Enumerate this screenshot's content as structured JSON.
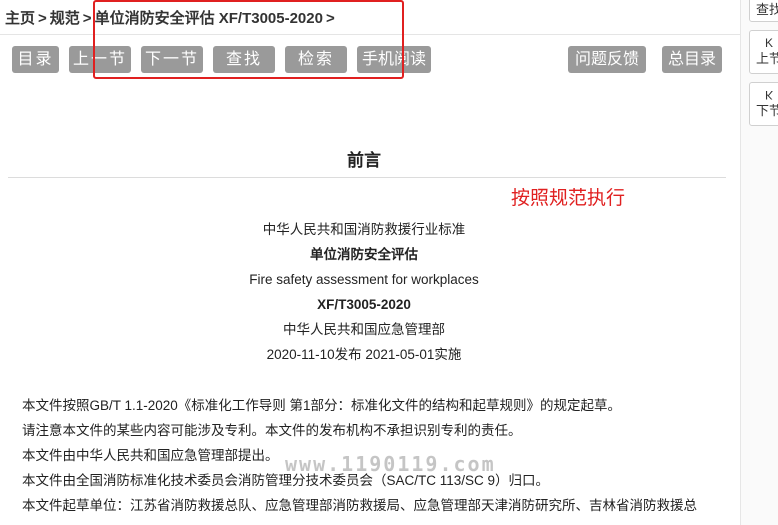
{
  "breadcrumb": {
    "home": "主页",
    "sep": ">",
    "section": "规范",
    "doc": "单位消防安全评估 XF/T3005-2020",
    "tail": ">"
  },
  "toolbar": {
    "toc": "目录",
    "prev": "上一节",
    "next": "下一节",
    "find": "查找",
    "search": "检索",
    "mobile": "手机阅读",
    "feedback": "问题反馈",
    "master_toc": "总目录"
  },
  "content": {
    "title": "前言",
    "annotation": "按照规范执行",
    "lines": [
      "中华人民共和国消防救援行业标准",
      "单位消防安全评估",
      "Fire safety assessment for workplaces",
      "XF/T3005-2020",
      "中华人民共和国应急管理部",
      "2020-11-10发布 2021-05-01实施"
    ],
    "paragraphs": [
      "本文件按照GB/T 1.1-2020《标准化工作导则 第1部分：标准化文件的结构和起草规则》的规定起草。",
      "请注意本文件的某些内容可能涉及专利。本文件的发布机构不承担识别专利的责任。",
      "本文件由中华人民共和国应急管理部提出。",
      "本文件由全国消防标准化技术委员会消防管理分技术委员会（SAC/TC 113/SC 9）归口。",
      "本文件起草单位：江苏省消防救援总队、应急管理部消防救援局、应急管理部天津消防研究所、吉林省消防救援总"
    ],
    "watermark": "www.1190119.com"
  },
  "right_panel": {
    "find": "查找",
    "prev_arrow": "K",
    "prev": "上节",
    "next_arrow": "K",
    "next": "下节"
  },
  "colors": {
    "button_bg": "#9a9a9a",
    "annotation": "#e02020"
  }
}
